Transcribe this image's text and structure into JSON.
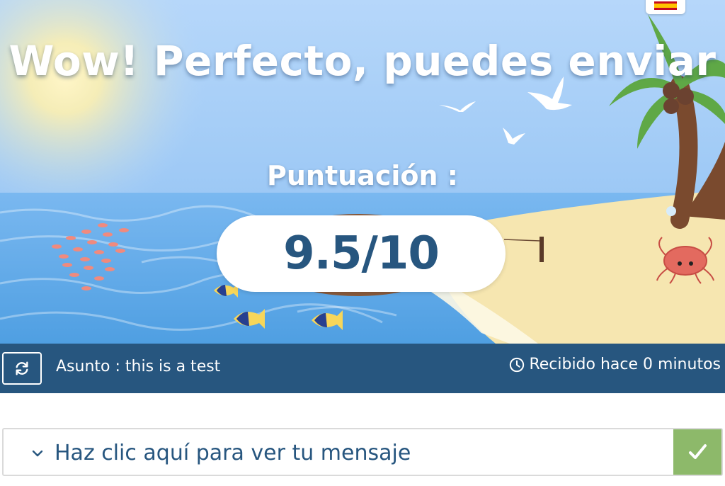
{
  "hero": {
    "headline": "Wow! Perfecto, puedes enviar",
    "score_label": "Puntuación :",
    "score_value": "9.5/10"
  },
  "language": {
    "icon": "spain-flag-icon"
  },
  "info_bar": {
    "refresh_icon": "refresh-icon",
    "subject": "Asunto : this is a test",
    "received_icon": "clock-icon",
    "received": "Recibido hace 0 minutos"
  },
  "message": {
    "toggle_label": "Haz clic aquí para ver tu mensaje",
    "chevron_icon": "chevron-down-icon",
    "status_icon": "check-icon"
  },
  "colors": {
    "primary": "#27567f",
    "success": "#8db96a",
    "sky": "#a9cef7",
    "sea": "#5da9e8",
    "sand": "#f6e6b0"
  }
}
